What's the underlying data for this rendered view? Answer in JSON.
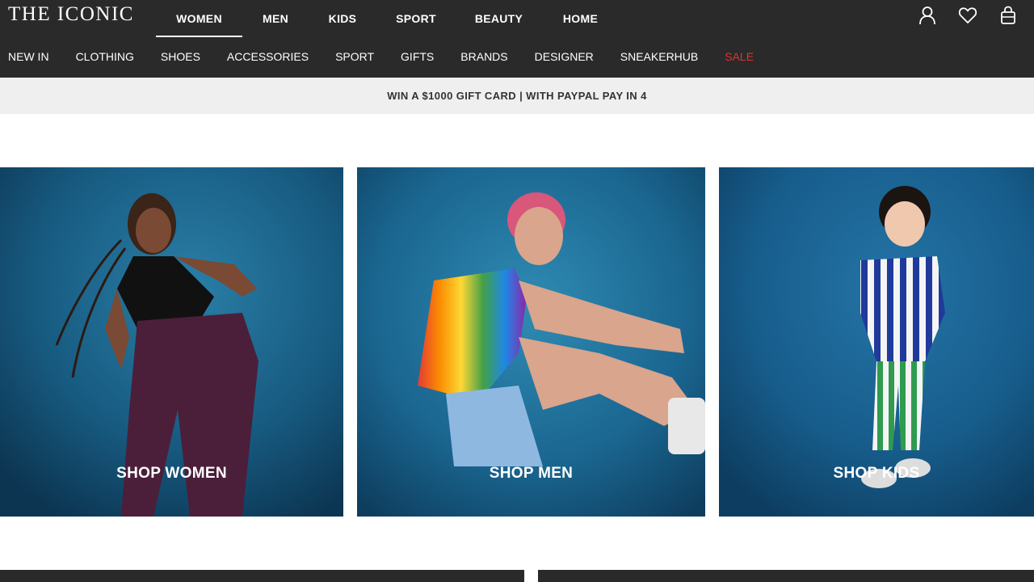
{
  "brand": {
    "logo_text": "THE ICONIC"
  },
  "top_nav": [
    {
      "label": "WOMEN",
      "active": true
    },
    {
      "label": "MEN",
      "active": false
    },
    {
      "label": "KIDS",
      "active": false
    },
    {
      "label": "SPORT",
      "active": false
    },
    {
      "label": "BEAUTY",
      "active": false
    },
    {
      "label": "HOME",
      "active": false
    }
  ],
  "header_icons": [
    "account-icon",
    "wishlist-heart-icon",
    "shopping-bag-icon"
  ],
  "sub_nav": [
    {
      "label": "NEW IN"
    },
    {
      "label": "CLOTHING"
    },
    {
      "label": "SHOES"
    },
    {
      "label": "ACCESSORIES"
    },
    {
      "label": "SPORT"
    },
    {
      "label": "GIFTS"
    },
    {
      "label": "BRANDS"
    },
    {
      "label": "DESIGNER"
    },
    {
      "label": "SNEAKERHUB"
    },
    {
      "label": "SALE",
      "highlight": true
    }
  ],
  "promo_banner": {
    "text": "WIN A $1000 GIFT CARD | WITH PAYPAL PAY IN 4"
  },
  "tiles": [
    {
      "label": "SHOP WOMEN"
    },
    {
      "label": "SHOP MEN"
    },
    {
      "label": "SHOP KIDS"
    }
  ],
  "colors": {
    "header_bg": "#2a2a2a",
    "promo_bg": "#efefef",
    "sale": "#e0332e",
    "tile_backdrop": "#1d5f86"
  }
}
